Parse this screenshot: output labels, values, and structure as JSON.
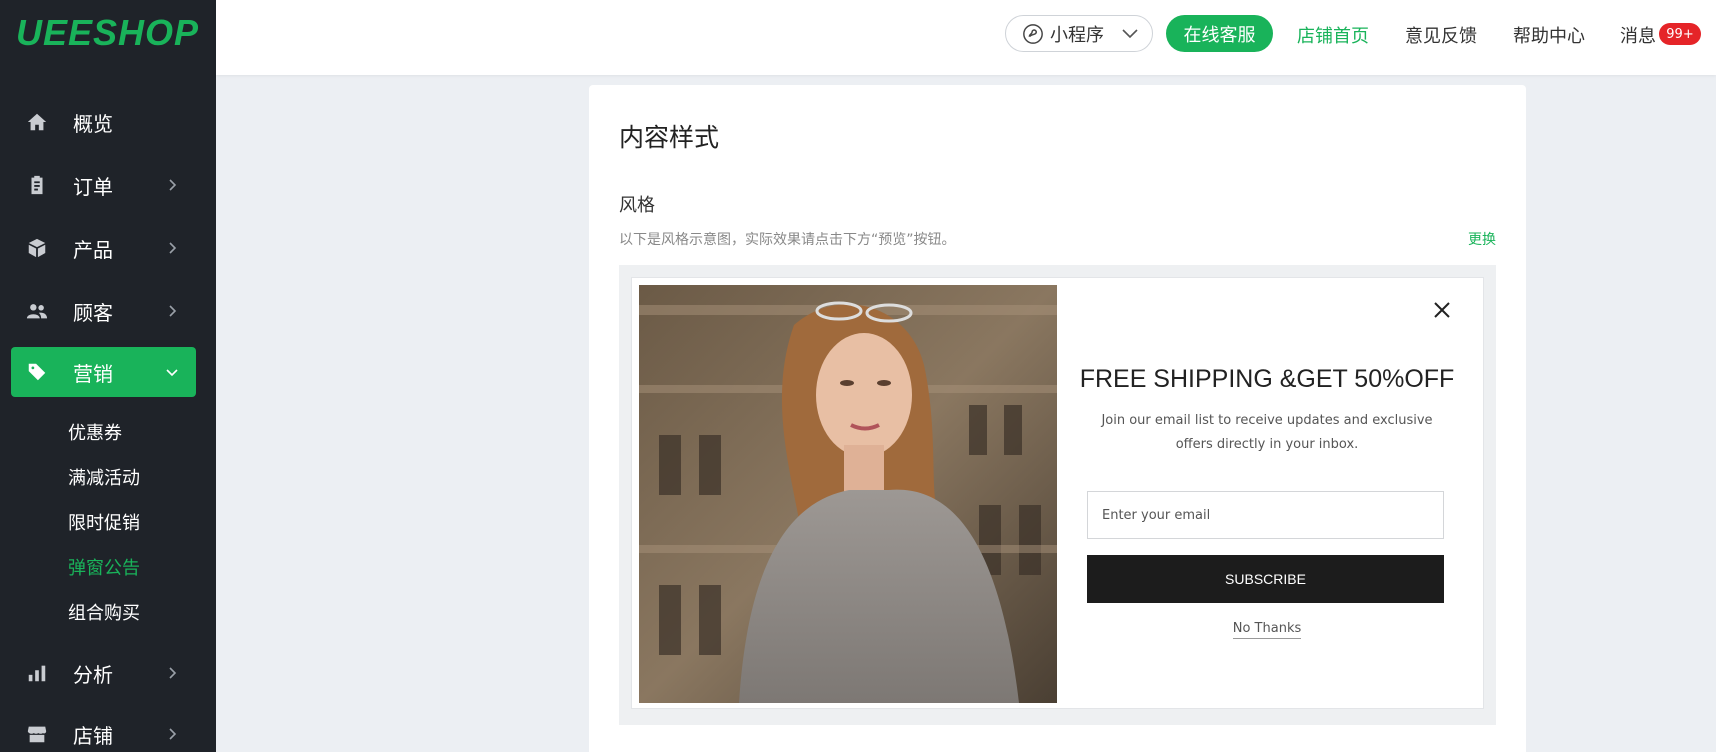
{
  "brand": {
    "logo_text": "UEESHOP",
    "accent": "#19b35a"
  },
  "sidebar": {
    "items": [
      {
        "label": "概览",
        "icon": "home-icon"
      },
      {
        "label": "订单",
        "icon": "clipboard-icon"
      },
      {
        "label": "产品",
        "icon": "box-icon"
      },
      {
        "label": "顾客",
        "icon": "users-icon"
      },
      {
        "label": "营销",
        "icon": "tag-icon",
        "active": true
      },
      {
        "label": "分析",
        "icon": "bar-chart-icon"
      },
      {
        "label": "店铺",
        "icon": "store-icon"
      }
    ],
    "sub_items": [
      {
        "label": "优惠券"
      },
      {
        "label": "满减活动"
      },
      {
        "label": "限时促销"
      },
      {
        "label": "弹窗公告",
        "current": true
      },
      {
        "label": "组合购买"
      }
    ]
  },
  "topbar": {
    "mini_program_label": "小程序",
    "online_service_label": "在线客服",
    "links": [
      "店铺首页",
      "意见反馈",
      "帮助中心",
      "消息"
    ],
    "message_badge": "99+"
  },
  "card": {
    "title": "内容样式",
    "section_label": "风格",
    "hint": "以下是风格示意图，实际效果请点击下方“预览”按钮。",
    "change_label": "更换"
  },
  "popup": {
    "title": "FREE SHIPPING &GET 50%OFF",
    "description": "Join our email list to receive updates and exclusive offers directly in your inbox.",
    "email_placeholder": "Enter your email",
    "subscribe_label": "SUBSCRIBE",
    "no_thanks_label": "No Thanks"
  }
}
